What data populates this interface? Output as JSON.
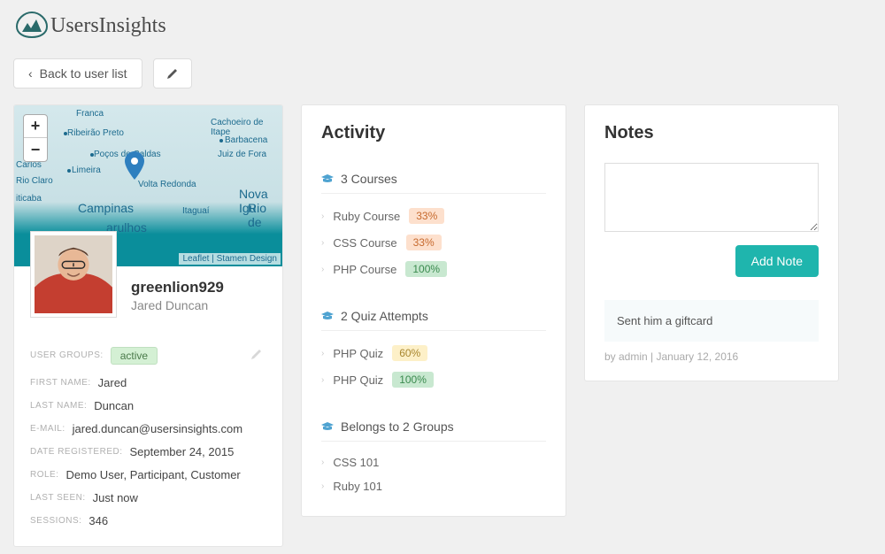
{
  "brand": "UsersInsights",
  "toolbar": {
    "back_label": "Back to user list"
  },
  "map": {
    "cities": [
      "Franca",
      "Cachoeiro de Itape",
      "Ribeirão Preto",
      "Barbacena",
      "Poços de Caldas",
      "Juiz de Fora",
      "Carlos",
      "Limeira",
      "Volta Redonda",
      "Rio Claro",
      "Nova Igu",
      "Campinas",
      "Itaguaí",
      "Rio de",
      "iticaba",
      "arulhos"
    ],
    "attribution_leaflet": "Leaflet",
    "attribution_stamen": "Stamen Design"
  },
  "profile": {
    "username": "greenlion929",
    "fullname": "Jared Duncan",
    "groups_label": "User Groups:",
    "groups_tag": "active",
    "firstname_label": "First Name:",
    "firstname_value": "Jared",
    "lastname_label": "Last Name:",
    "lastname_value": "Duncan",
    "email_label": "E-mail:",
    "email_value": "jared.duncan@usersinsights.com",
    "registered_label": "Date Registered:",
    "registered_value": "September 24, 2015",
    "role_label": "Role:",
    "role_value": "Demo User, Participant, Customer",
    "lastseen_label": "Last Seen:",
    "lastseen_value": "Just now",
    "sessions_label": "Sessions:",
    "sessions_value": "346"
  },
  "activity": {
    "title": "Activity",
    "courses_header": "3 Courses",
    "courses": [
      {
        "name": "Ruby Course",
        "pct": "33%",
        "cls": "pct-orange"
      },
      {
        "name": "CSS Course",
        "pct": "33%",
        "cls": "pct-orange"
      },
      {
        "name": "PHP Course",
        "pct": "100%",
        "cls": "pct-green"
      }
    ],
    "quiz_header": "2 Quiz Attempts",
    "quizzes": [
      {
        "name": "PHP Quiz",
        "pct": "60%",
        "cls": "pct-yellow"
      },
      {
        "name": "PHP Quiz",
        "pct": "100%",
        "cls": "pct-green"
      }
    ],
    "groups_header": "Belongs to 2 Groups",
    "groups": [
      {
        "name": "CSS 101"
      },
      {
        "name": "Ruby 101"
      }
    ]
  },
  "notes": {
    "title": "Notes",
    "add_button": "Add Note",
    "items": [
      {
        "text": "Sent him a giftcard",
        "meta": "by admin | January 12, 2016"
      }
    ]
  }
}
